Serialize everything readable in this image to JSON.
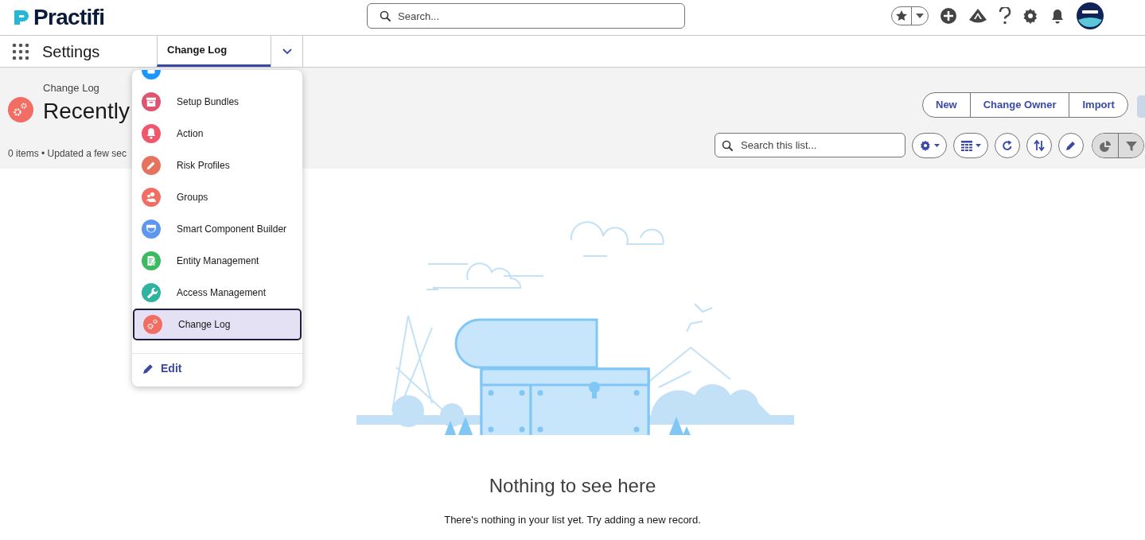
{
  "header": {
    "logo": "Practifi",
    "search": {
      "placeholder": "Search..."
    }
  },
  "nav": {
    "app_name": "Settings",
    "tabs": [
      {
        "label": "Change Log",
        "selected": true
      }
    ]
  },
  "dropdown": {
    "items": [
      {
        "kind": "bin",
        "color": "#1b96ff",
        "selected": false
      },
      {
        "label": "Setup Bundles",
        "kind": "box",
        "color": "#dd5570",
        "selected": false
      },
      {
        "label": "Action",
        "kind": "bell",
        "color": "#f0576c",
        "selected": false
      },
      {
        "label": "Risk Profiles",
        "kind": "pencil",
        "color": "#e5735f",
        "selected": false
      },
      {
        "label": "Groups",
        "kind": "people",
        "color": "#f26d63",
        "selected": false
      },
      {
        "label": "Smart Component Builder",
        "kind": "shield",
        "color": "#5e97ef",
        "selected": false
      },
      {
        "label": "Entity Management",
        "kind": "doc",
        "color": "#3bba62",
        "selected": false
      },
      {
        "label": "Access Management",
        "kind": "wrench",
        "color": "#2fb3a0",
        "selected": false
      },
      {
        "label": "Change Log",
        "kind": "gears",
        "color": "#f26d63",
        "selected": true
      }
    ],
    "edit_label": "Edit"
  },
  "list_header": {
    "object_label": "Change Log",
    "title": "Recently",
    "status": "0 items • Updated a few sec",
    "actions": [
      "New",
      "Change Owner",
      "Import"
    ],
    "search": {
      "placeholder": "Search this list..."
    },
    "tools": [
      {
        "kind": "gear",
        "disabled": false
      },
      {
        "kind": "table",
        "disabled": false
      },
      {
        "kind": "refresh",
        "disabled": false
      },
      {
        "kind": "sort",
        "disabled": false
      },
      {
        "kind": "edit",
        "disabled": false
      },
      {
        "kind": "chart",
        "disabled": true
      },
      {
        "kind": "filter",
        "disabled": true
      }
    ]
  },
  "empty_state": {
    "title": "Nothing to see here",
    "message": "There's nothing in your list yet. Try adding a new record."
  }
}
